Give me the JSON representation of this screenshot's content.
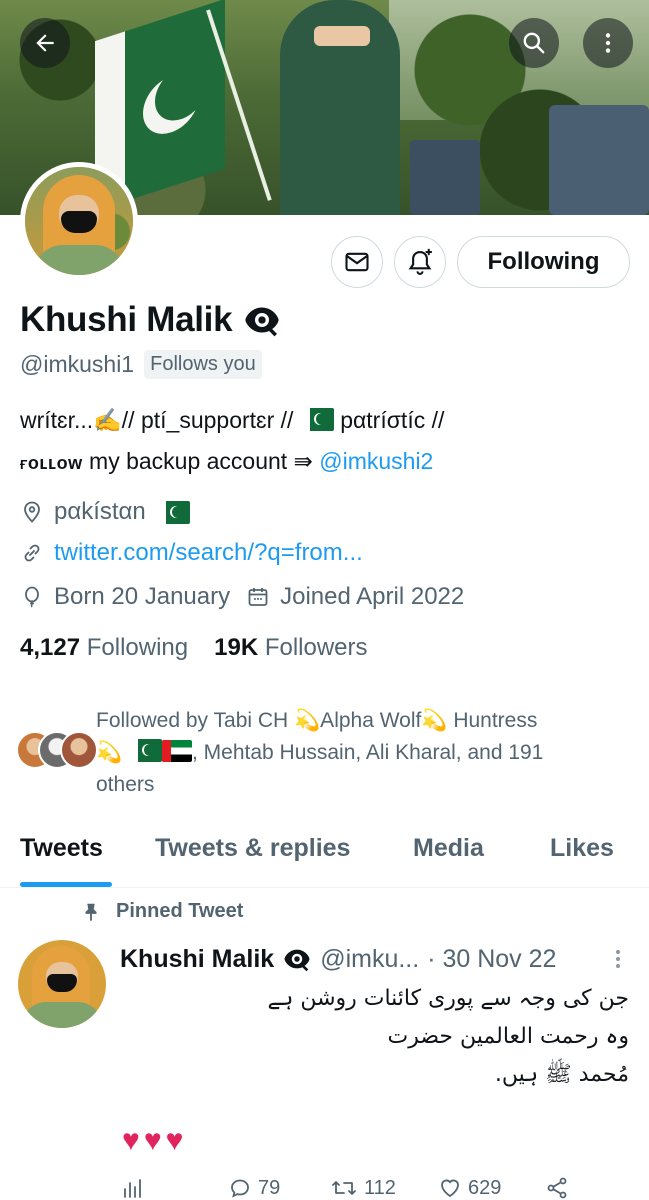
{
  "banner": {
    "back_icon": "arrow-left-icon",
    "search_icon": "search-icon",
    "more_icon": "more-vertical-icon"
  },
  "actions": {
    "message_icon": "envelope-icon",
    "notify_icon": "bell-plus-icon",
    "follow_label": "Following"
  },
  "profile": {
    "name": "Khushi Malik",
    "badge_icon": "eye-icon",
    "handle": "@imkushi1",
    "follows_you": "Follows you",
    "bio_line1_a": "wrítɛr...✍️// ptí_supportɛr //",
    "bio_line1_b": "pαtríσtíc //",
    "bio_line2_a": "ғᴏʟʟᴏᴡ",
    "bio_line2_b": " my backup account ⇛ ",
    "bio_mention": "@imkushi2",
    "location": "pαkístαn",
    "website": "twitter.com/search/?q=from...",
    "birthday": "Born 20 January",
    "joined": "Joined April 2022",
    "following_count": "4,127",
    "following_label": "Following",
    "followers_count": "19K",
    "followers_label": "Followers",
    "followed_by_1": "Followed by Tabi CH 💫Alpha Wolf💫 Huntress",
    "followed_by_2": ", Mehtab Hussain, Ali Kharal, and 191",
    "followed_by_3": "others"
  },
  "tabs": [
    "Tweets",
    "Tweets & replies",
    "Media",
    "Likes"
  ],
  "tweet": {
    "pinned_label": "Pinned Tweet",
    "name": "Khushi Malik",
    "handle": "@imku...",
    "date": "· 30 Nov 22",
    "line1": "جن کی وجہ سے پوری کائنات روشن ہے",
    "line2": "وہ رحمت العالمین حضرت",
    "line3": "مُحمد ﷺ ہیں.",
    "hearts": "♥♥♥",
    "replies": "79",
    "retweets": "112",
    "likes": "629"
  },
  "colors": {
    "accent": "#1d9bf0",
    "text": "#0f1419",
    "muted": "#536471",
    "heart": "#e0245e"
  }
}
